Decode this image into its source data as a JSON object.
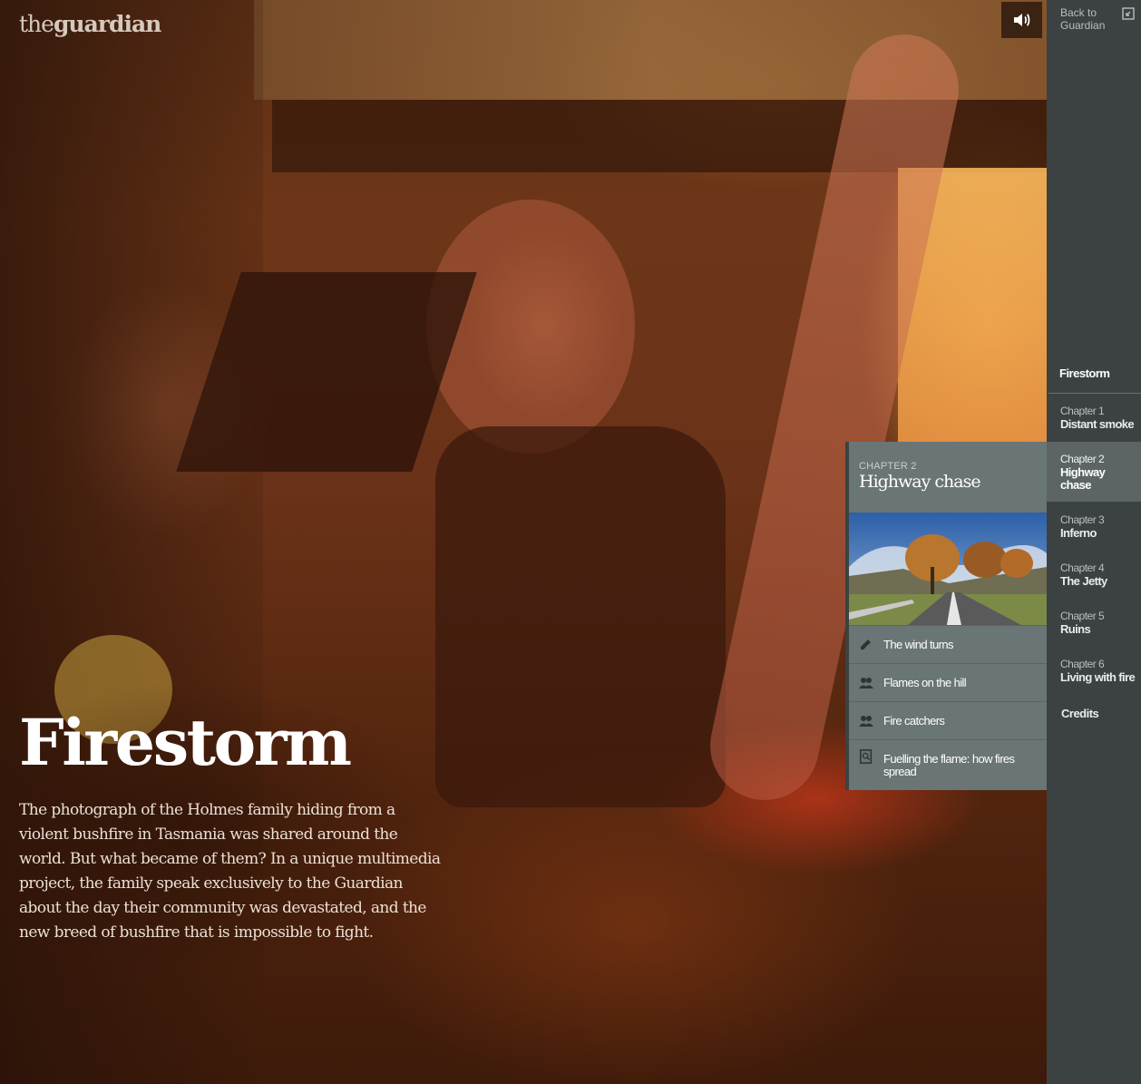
{
  "header": {
    "logo_the": "the",
    "logo_name": "guardian",
    "sound_icon": "speaker-icon"
  },
  "hero": {
    "title": "Firestorm",
    "standfirst": "The photograph of the Holmes family hiding from a violent bushfire in Tasmania was shared around the world. But what became of them? In a unique multimedia project, the family speak exclusively to the Guardian about the day their community was devastated, and the new breed of bushfire that is impossible to fight."
  },
  "sidebar": {
    "back_label": "Back to Guardian",
    "back_icon": "exit-icon",
    "title": "Firestorm",
    "chapters": [
      {
        "num": "Chapter 1",
        "name": "Distant smoke"
      },
      {
        "num": "Chapter 2",
        "name": "Highway chase"
      },
      {
        "num": "Chapter 3",
        "name": "Inferno"
      },
      {
        "num": "Chapter 4",
        "name": "The Jetty"
      },
      {
        "num": "Chapter 5",
        "name": "Ruins"
      },
      {
        "num": "Chapter 6",
        "name": "Living with fire"
      }
    ],
    "active_chapter": 2,
    "credits": "Credits"
  },
  "flyout": {
    "kicker": "CHAPTER 2",
    "title": "Highway chase",
    "items": [
      {
        "label": "The wind turns",
        "icon": "pencil-icon"
      },
      {
        "label": "Flames on the hill",
        "icon": "people-icon"
      },
      {
        "label": "Fire catchers",
        "icon": "people-icon"
      },
      {
        "label": "Fuelling the flame: how fires spread",
        "icon": "document-search-icon"
      }
    ]
  },
  "colors": {
    "sidebar_bg": "#3c4142",
    "sidebar_active": "#5c6464",
    "flyout_bg": "#6a7575"
  }
}
